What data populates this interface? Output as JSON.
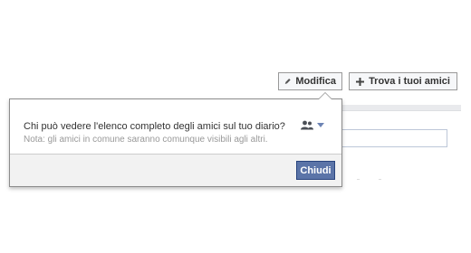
{
  "toolbar": {
    "edit_label": "Modifica",
    "find_friends_label": "Trova i tuoi amici",
    "edit_icon": "pencil-icon",
    "find_friends_icon": "plus-icon"
  },
  "popover": {
    "question": "Chi può vedere l'elenco completo degli amici sul tuo diario?",
    "note": "Nota: gli amici in comune saranno comunque visibili agli altri.",
    "audience_icon": "friends-icon",
    "close_label": "Chiudi"
  },
  "colors": {
    "primary_button": "#5b74a8",
    "primary_button_border": "#29447e",
    "dropdown_arrow": "#6d84b4",
    "note_text": "#999999"
  }
}
